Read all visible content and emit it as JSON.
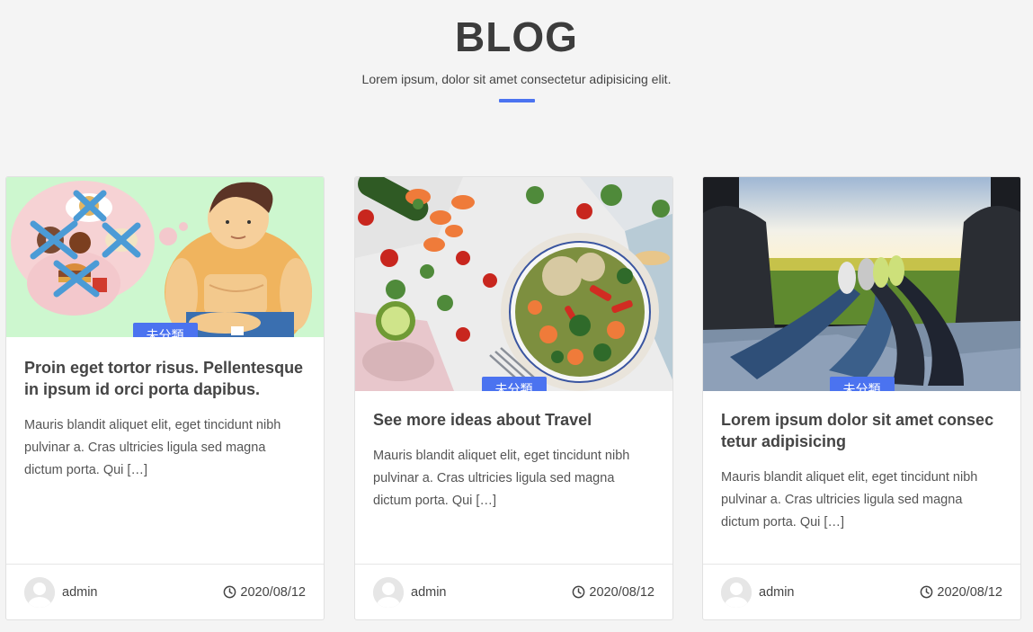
{
  "header": {
    "title": "BLOG",
    "subtitle": "Lorem ipsum, dolor sit amet consectetur adipisicing elit.",
    "accent_color": "#4b73f0"
  },
  "posts": [
    {
      "category": "未分類",
      "title": "Proin eget tortor risus. Pellentesque in ipsum id orci porta dapibus.",
      "excerpt": "Mauris blandit aliquet elit, eget tincidunt nibh pulvinar a. Cras ultricies ligula sed magna dictum porta. Qui […]",
      "author": "admin",
      "date": "2020/08/12",
      "image": "diet-illustration"
    },
    {
      "category": "未分類",
      "title": "See more ideas about Travel",
      "excerpt": "Mauris blandit aliquet elit, eget tincidunt nibh pulvinar a. Cras ultricies ligula sed magna dictum porta. Qui […]",
      "author": "admin",
      "date": "2020/08/12",
      "image": "salad-bowl-photo"
    },
    {
      "category": "未分類",
      "title": "Lorem ipsum dolor sit amet consec tetur adipisicing",
      "excerpt": "Mauris blandit aliquet elit, eget tincidunt nibh pulvinar a. Cras ultricies ligula sed magna dictum porta. Qui […]",
      "author": "admin",
      "date": "2020/08/12",
      "image": "car-trunk-legs-photo"
    }
  ]
}
